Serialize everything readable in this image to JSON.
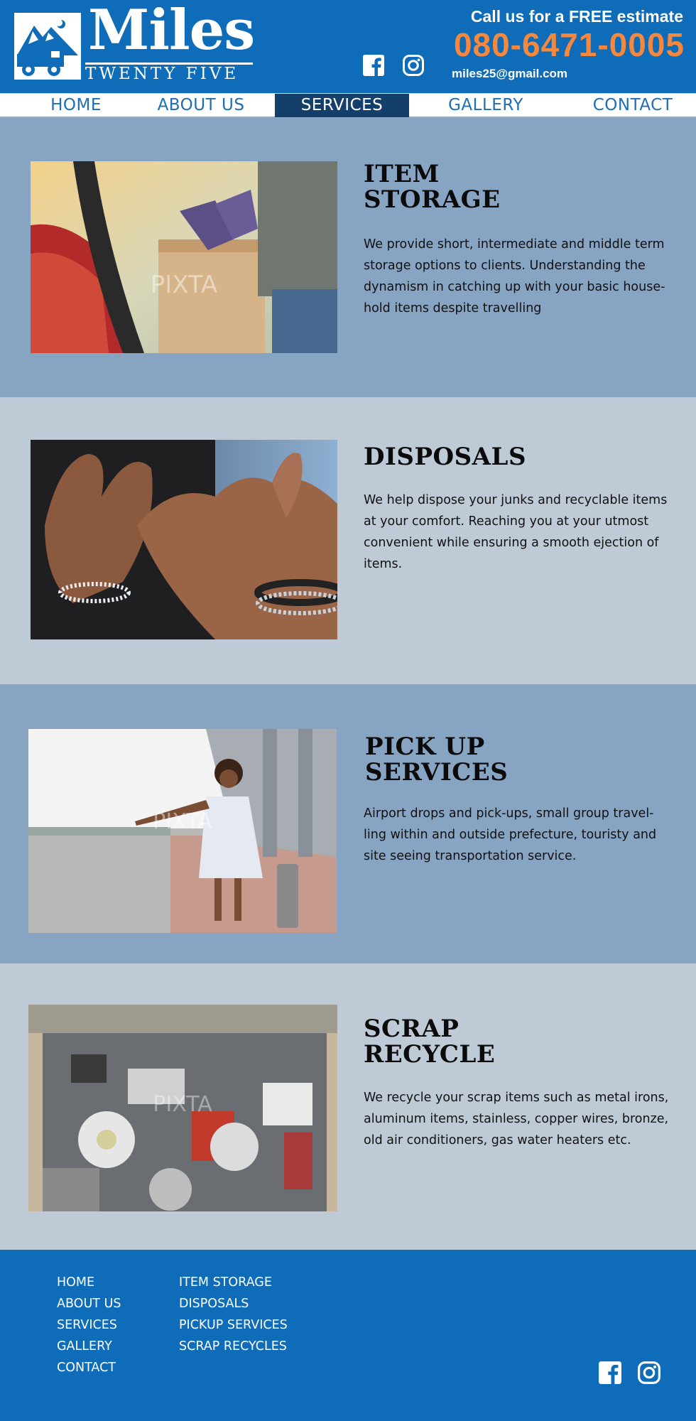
{
  "brand": {
    "name": "Miles",
    "tagline": "TWENTY FIVE"
  },
  "header": {
    "cta": "Call us for a FREE estimate",
    "phone": "080-6471-0005",
    "email": "miles25@gmail.com",
    "social": [
      "facebook-icon",
      "instagram-icon"
    ]
  },
  "nav": {
    "items": [
      "HOME",
      "ABOUT US",
      "SERVICES",
      "GALLERY",
      "CONTACT"
    ],
    "active": "SERVICES"
  },
  "services": [
    {
      "title_1": "ITEM",
      "title_2": "STORAGE",
      "text": "We provide short, intermediate and middle term storage options to clients. Understanding the dynamism in catching up with your basic house-hold items despite travelling"
    },
    {
      "title_1": "DISPOSALS",
      "title_2": "",
      "text": "We help dispose your junks and recyclable items at your comfort. Reaching you at your utmost convenient while ensuring a smooth ejection of items."
    },
    {
      "title_1": "PICK UP",
      "title_2": "SERVICES",
      "text": "Airport drops and pick-ups, small group travel-ling within and outside prefecture, touristy and site seeing transportation service."
    },
    {
      "title_1": "SCRAP",
      "title_2": "RECYCLE",
      "text": "We recycle your scrap items such as metal irons, aluminum items, stainless, copper wires, bronze, old air conditioners, gas water heaters etc."
    }
  ],
  "photos": {
    "watermark": "PIXTA"
  },
  "footer": {
    "col1": [
      "HOME",
      "ABOUT US",
      "SERVICES",
      "GALLERY",
      "CONTACT"
    ],
    "col2": [
      "ITEM STORAGE",
      "DISPOSALS",
      "PICKUP SERVICES",
      "SCRAP RECYCLES"
    ],
    "social": [
      "facebook-icon",
      "instagram-icon"
    ]
  },
  "colors": {
    "primary": "#0e6cb9",
    "accent": "#f5883c",
    "nav_active": "#153f6b",
    "band_dark": "#88a4c3",
    "band_light": "#bfcad7"
  }
}
